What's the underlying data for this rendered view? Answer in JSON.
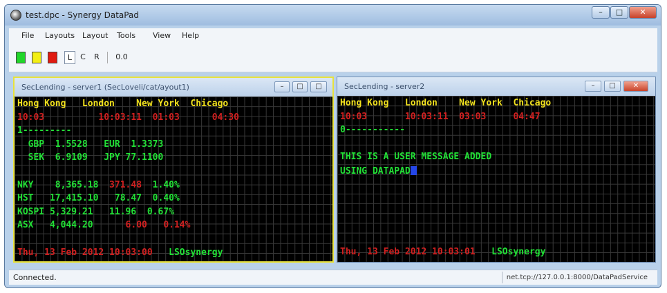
{
  "window": {
    "title": "test.dpc - Synergy DataPad",
    "controls": [
      "–",
      "□",
      "✕"
    ]
  },
  "menu": [
    "File",
    "Layouts",
    "Layout",
    "Tools",
    "View",
    "Help"
  ],
  "toolbar": {
    "swatches": [
      {
        "name": "green",
        "color": "#21d62a"
      },
      {
        "name": "yellow",
        "color": "#f3ef14"
      },
      {
        "name": "red",
        "color": "#e01a10"
      }
    ],
    "buttons": [
      "L",
      "C",
      "R"
    ],
    "zoom": "0.0"
  },
  "panel_left": {
    "title": "SecLending - server1 (SecLoveli/cat/ayout1)",
    "rows": [
      [
        {
          "t": "Hong Kong   London    New York  Chicago",
          "c": "yel"
        }
      ],
      [
        {
          "t": "10:03          10:03:11  01:03      04:30",
          "c": "red"
        }
      ],
      [
        {
          "t": "1---------",
          "c": "grn"
        }
      ],
      [
        {
          "t": "  GBP  1.5528   EUR  1.3373",
          "c": "grn"
        }
      ],
      [
        {
          "t": "  SEK  6.9109   JPY 77.1100",
          "c": "grn"
        }
      ],
      [
        {
          "t": "",
          "c": "grn"
        }
      ],
      [
        {
          "t": "NKY    8,365.18 ",
          "c": "grn"
        },
        {
          "t": " 371.48 ",
          "c": "red"
        },
        {
          "t": " 1.40%",
          "c": "grn"
        }
      ],
      [
        {
          "t": "HST   17,415.10   78.47  0.40%",
          "c": "grn"
        }
      ],
      [
        {
          "t": "KOSPI 5,329.21   11.96  0.67%",
          "c": "grn"
        }
      ],
      [
        {
          "t": "ASX   4,044.20 ",
          "c": "grn"
        },
        {
          "t": "     6.00   0.14%",
          "c": "red"
        }
      ],
      [
        {
          "t": "",
          "c": "grn"
        }
      ],
      [
        {
          "t": "Thu, 13 Feb 2012 10:03:00 ",
          "c": "red"
        },
        {
          "t": "  LSOsynergy",
          "c": "grn"
        }
      ]
    ]
  },
  "panel_right": {
    "title": "SecLending - server2",
    "rows": [
      [
        {
          "t": "Hong Kong   London    New York  Chicago",
          "c": "yel"
        }
      ],
      [
        {
          "t": "10:03       10:03:11  03:03     04:47",
          "c": "red"
        }
      ],
      [
        {
          "t": "0-----------",
          "c": "grn"
        }
      ],
      [
        {
          "t": "",
          "c": "grn"
        }
      ],
      [
        {
          "t": "THIS IS A USER MESSAGE ADDED",
          "c": "grn"
        }
      ],
      [
        {
          "t": "USING DATAPAD",
          "c": "grn"
        }
      ],
      [
        {
          "t": "",
          "c": "grn"
        }
      ],
      [
        {
          "t": "",
          "c": "grn"
        }
      ],
      [
        {
          "t": "",
          "c": "grn"
        }
      ],
      [
        {
          "t": "",
          "c": "grn"
        }
      ],
      [
        {
          "t": "",
          "c": "grn"
        }
      ],
      [
        {
          "t": "Thu, 13 Feb 2012 10:03:01 ",
          "c": "red"
        },
        {
          "t": "  LSOsynergy",
          "c": "grn"
        }
      ]
    ]
  },
  "status": {
    "left": "Connected.",
    "right": "net.tcp://127.0.0.1:8000/DataPadService"
  }
}
